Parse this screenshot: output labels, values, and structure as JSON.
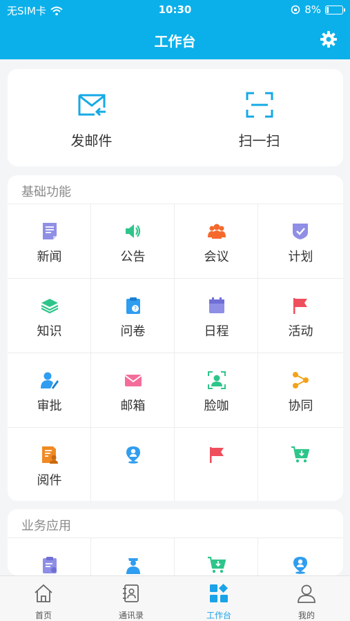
{
  "status": {
    "carrier": "无SIM卡",
    "time": "10:30",
    "battery": "8%"
  },
  "header": {
    "title": "工作台"
  },
  "quick_actions": [
    {
      "label": "发邮件",
      "icon": "mail-send-icon"
    },
    {
      "label": "扫一扫",
      "icon": "scan-icon"
    }
  ],
  "basic_section": {
    "title": "基础功能",
    "items": [
      {
        "label": "新闻",
        "icon": "news-icon"
      },
      {
        "label": "公告",
        "icon": "speaker-icon"
      },
      {
        "label": "会议",
        "icon": "meeting-icon"
      },
      {
        "label": "计划",
        "icon": "plan-shield-icon"
      },
      {
        "label": "知识",
        "icon": "layers-icon"
      },
      {
        "label": "问卷",
        "icon": "questionnaire-icon"
      },
      {
        "label": "日程",
        "icon": "calendar-icon"
      },
      {
        "label": "活动",
        "icon": "flag-icon"
      },
      {
        "label": "审批",
        "icon": "approve-icon"
      },
      {
        "label": "邮箱",
        "icon": "mailbox-icon"
      },
      {
        "label": "脸咖",
        "icon": "face-scan-icon"
      },
      {
        "label": "协同",
        "icon": "collaborate-icon"
      },
      {
        "label": "阅件",
        "icon": "read-doc-icon"
      },
      {
        "label": "",
        "icon": "location-person-icon"
      },
      {
        "label": "",
        "icon": "flag-icon"
      },
      {
        "label": "",
        "icon": "cart-download-icon"
      }
    ]
  },
  "business_section": {
    "title": "业务应用",
    "items": [
      {
        "label": "",
        "icon": "clipboard-icon"
      },
      {
        "label": "",
        "icon": "officer-icon"
      },
      {
        "label": "",
        "icon": "cart-download-icon"
      },
      {
        "label": "",
        "icon": "location-person-icon"
      }
    ]
  },
  "tabbar": [
    {
      "label": "首页",
      "icon": "home-icon",
      "active": false
    },
    {
      "label": "通讯录",
      "icon": "contacts-icon",
      "active": false
    },
    {
      "label": "工作台",
      "icon": "workbench-icon",
      "active": true
    },
    {
      "label": "我的",
      "icon": "profile-icon",
      "active": false
    }
  ],
  "colors": {
    "header": "#0bb0ea",
    "accent": "#1aa3e8"
  }
}
